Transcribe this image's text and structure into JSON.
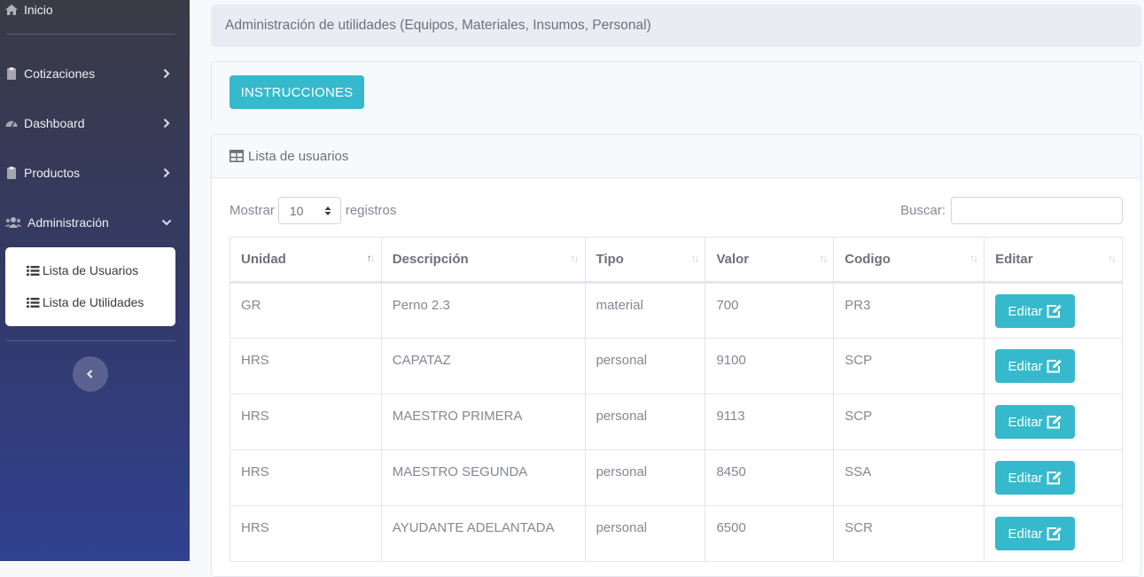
{
  "sidebar": {
    "home": "Inicio",
    "items": [
      {
        "label": "Cotizaciones",
        "icon": "clipboard-icon"
      },
      {
        "label": "Dashboard",
        "icon": "tachometer-icon"
      },
      {
        "label": "Productos",
        "icon": "clipboard-icon"
      },
      {
        "label": "Administración",
        "icon": "users-icon"
      }
    ],
    "submenu": [
      "Lista de Usuarios",
      "Lista de Utilidades"
    ]
  },
  "breadcrumb": "Administración de utilidades (Equipos, Materiales, Insumos, Personal)",
  "instructions_button": "INSTRUCCIONES",
  "card_title": "Lista de usuarios",
  "length_control": {
    "prefix": "Mostrar",
    "value": "10",
    "suffix": "registros"
  },
  "search_label": "Buscar:",
  "table": {
    "headers": [
      "Unidad",
      "Descripción",
      "Tipo",
      "Valor",
      "Codigo",
      "Editar"
    ],
    "rows": [
      [
        "GR",
        "Perno 2.3",
        "material",
        "700",
        "PR3"
      ],
      [
        "HRS",
        "CAPATAZ",
        "personal",
        "9100",
        "SCP"
      ],
      [
        "HRS",
        "MAESTRO PRIMERA",
        "personal",
        "9113",
        "SCP"
      ],
      [
        "HRS",
        "MAESTRO SEGUNDA",
        "personal",
        "8450",
        "SSA"
      ],
      [
        "HRS",
        "AYUDANTE ADELANTADA",
        "personal",
        "6500",
        "SCR"
      ]
    ],
    "edit_label": "Editar"
  },
  "colors": {
    "accent": "#36b9cc",
    "sidebar_top": "#3a3b45",
    "sidebar_bottom": "#2f4190"
  }
}
